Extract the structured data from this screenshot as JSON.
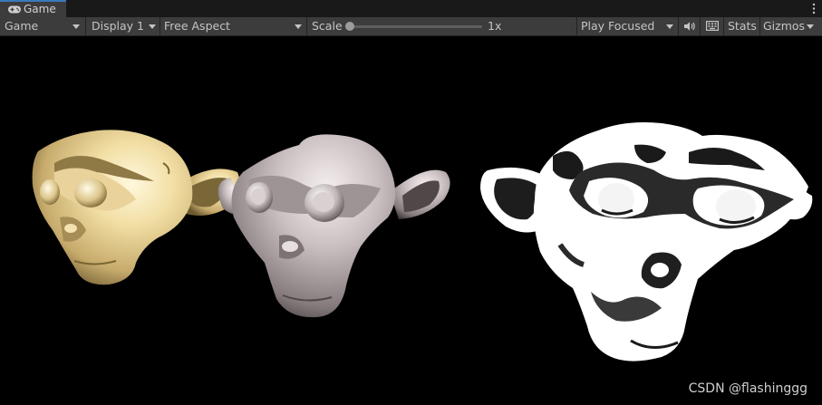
{
  "tab": {
    "title": "Game",
    "icon": "gamepad-icon"
  },
  "toolbar": {
    "view_select": "Game",
    "display_select": "Display 1",
    "aspect_select": "Free Aspect",
    "scale_label": "Scale",
    "scale_value": "1x",
    "scale_slider_fraction": 0,
    "play_mode_select": "Play Focused",
    "mute_icon": "speaker-icon",
    "stats_label": "Stats",
    "gizmos_label": "Gizmos"
  },
  "viewport": {
    "models": [
      {
        "name": "gold-monkey-head",
        "material": "gold metallic",
        "color": "#f1dfa6"
      },
      {
        "name": "silver-monkey-head",
        "material": "silver metallic",
        "color": "#c9bfc1"
      },
      {
        "name": "toon-monkey-head",
        "material": "white toon shading",
        "color": "#ffffff"
      }
    ],
    "watermark": "CSDN @flashinggg"
  },
  "colors": {
    "tab_accent": "#3a79bb",
    "toolbar_bg": "#3c3c3c",
    "tabbar_bg": "#191919",
    "viewport_bg": "#000000"
  }
}
